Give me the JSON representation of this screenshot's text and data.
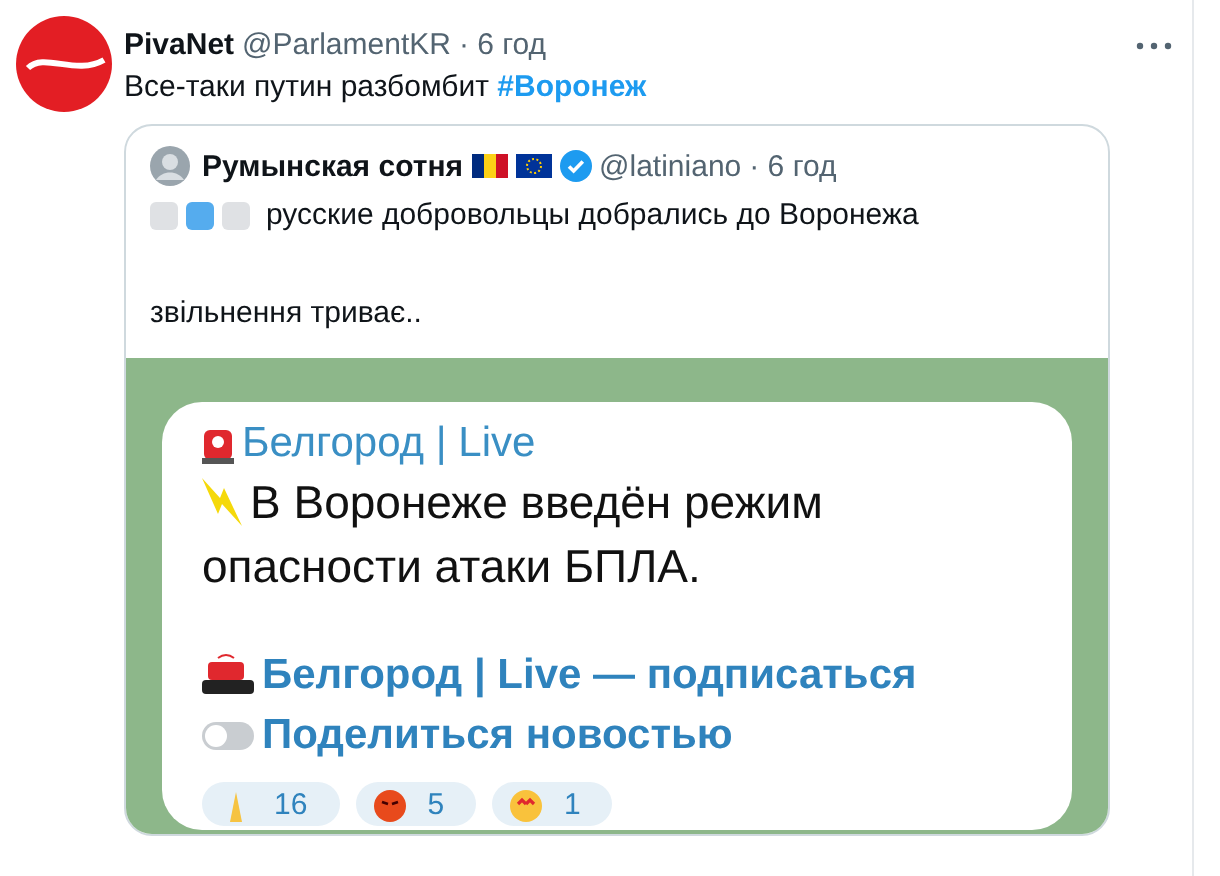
{
  "tweet": {
    "author": "PivaNet",
    "handle": "@ParlamentKR",
    "time": "· 6 год",
    "text": "Все-таки путин разбомбит",
    "hashtag": "#Воронеж",
    "quote": {
      "author": "Румынская сотня",
      "handle": "@latiniano",
      "time": "· 6 год",
      "verified": true,
      "emoji_squares": [
        {
          "color": "#dfe1e4"
        },
        {
          "color": "#55acee"
        },
        {
          "color": "#dfe1e4"
        }
      ],
      "text": "русские добровольцы добрались до Воронежа",
      "text_2": "звільнення триває..",
      "telegram_post": {
        "channel": "Белгород | Live",
        "message": [
          "В Воронеже введён режим",
          "опасности атаки БПЛА."
        ],
        "subscribe_link": "Белгород | Live — подписаться",
        "share_link": "Поделиться новостью",
        "reactions": [
          {
            "kind": "pray",
            "count": "16"
          },
          {
            "kind": "angry",
            "count": "5"
          },
          {
            "kind": "love",
            "count": "1"
          }
        ]
      }
    }
  }
}
